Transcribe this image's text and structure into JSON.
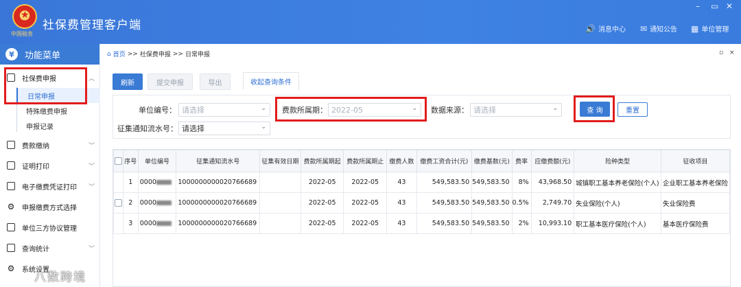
{
  "header": {
    "app_title": "社保费管理客户端",
    "logo_text": "中国税务",
    "links": [
      {
        "icon": "speaker-icon",
        "label": "消息中心"
      },
      {
        "icon": "mail-icon",
        "label": "通知公告"
      },
      {
        "icon": "building-icon",
        "label": "单位管理"
      }
    ],
    "window_controls": [
      "–",
      "▭",
      "✕"
    ]
  },
  "sidebar": {
    "title": "功能菜单",
    "items": [
      {
        "label": "社保费申报",
        "expanded": true
      },
      {
        "label": "费款缴纳"
      },
      {
        "label": "证明打印"
      },
      {
        "label": "电子缴费凭证打印"
      },
      {
        "label": "申报缴费方式选择"
      },
      {
        "label": "单位三方协议管理"
      },
      {
        "label": "查询统计"
      },
      {
        "label": "系统设置"
      }
    ],
    "subitems": [
      "日常申报",
      "特殊缴费申报",
      "申报记录"
    ],
    "active_sub": "日常申报"
  },
  "breadcrumb": {
    "home": "首页",
    "sep": ">>",
    "level1": "社保费申报",
    "level2": "日常申报",
    "ctrl_min": "▫",
    "ctrl_close": "×"
  },
  "toolbar": {
    "refresh": "刷新",
    "submit": "提交申报",
    "export": "导出",
    "toggle_tab": "收起查询条件"
  },
  "filters": {
    "unit_code_label": "单位编号：",
    "unit_code_value": "请选择",
    "period_label": "费款所属期：",
    "period_value": "2022-05",
    "source_label": "数据来源：",
    "source_value": "请选择",
    "notice_label": "征集通知流水号：",
    "notice_value": "请选择",
    "query": "查 询",
    "reset": "重置"
  },
  "table": {
    "columns": [
      "",
      "序号",
      "单位编号",
      "征集通知流水号",
      "征集有效日期",
      "费款所属期起",
      "费款所属期止",
      "缴费人数",
      "缴费工资合计(元)",
      "缴费基数(元)",
      "费率",
      "应缴费额(元)",
      "险种类型",
      "征收项目"
    ],
    "rows": [
      {
        "no": "1",
        "unit": "0000",
        "notice": "1000000000020766689",
        "valid": "",
        "start": "2022-05",
        "end": "2022-05",
        "count": "43",
        "wage": "549,583.50",
        "base": "549,583.50",
        "rate": "8%",
        "amount": "43,968.50",
        "type": "城镇职工基本养老保险(个人)",
        "item": "企业职工基本养老保险"
      },
      {
        "no": "2",
        "unit": "0000",
        "notice": "1000000000020766689",
        "valid": "",
        "start": "2022-05",
        "end": "2022-05",
        "count": "43",
        "wage": "549,583.50",
        "base": "549,583.50",
        "rate": "0.5%",
        "amount": "2,749.70",
        "type": "失业保险(个人)",
        "item": "失业保险费"
      },
      {
        "no": "3",
        "unit": "0000",
        "notice": "1000000000020766689",
        "valid": "",
        "start": "2022-05",
        "end": "2022-05",
        "count": "43",
        "wage": "549,583.50",
        "base": "549,583.50",
        "rate": "2%",
        "amount": "10,993.10",
        "type": "职工基本医疗保险(个人)",
        "item": "基本医疗保险费"
      }
    ]
  },
  "watermark": "八数跨境",
  "colors": {
    "header": "#3a7bd5",
    "accent": "#2f6fd6",
    "highlight": "#e21b1b"
  }
}
